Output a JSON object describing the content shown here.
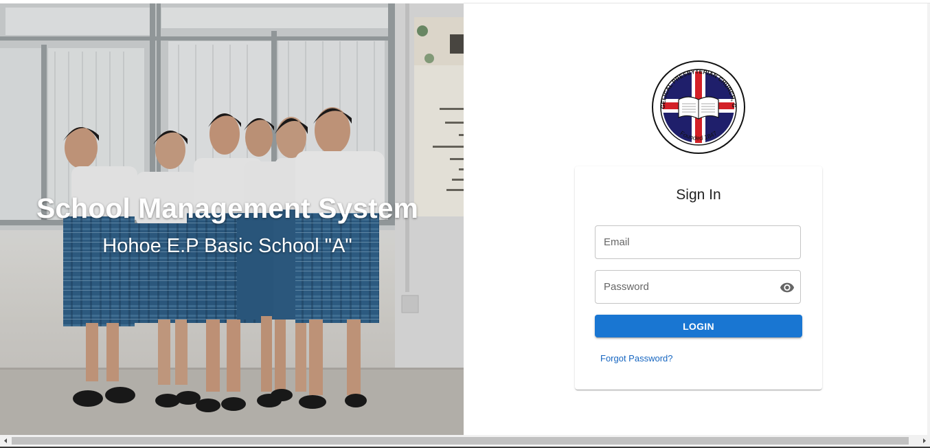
{
  "hero": {
    "title": "School Management System",
    "subtitle": "Hohoe E.P Basic School \"A\""
  },
  "logo": {
    "arc_text_top": "EVANGELICAL PRESBYTERIAN CHURCH, GHANA",
    "arc_text_bottom": "Founded 1847"
  },
  "signin": {
    "title": "Sign In",
    "email_placeholder": "Email",
    "email_value": "",
    "password_placeholder": "Password",
    "password_value": "",
    "login_label": "LOGIN",
    "forgot_label": "Forgot Password?"
  },
  "icons": {
    "password_toggle": "eye-icon",
    "scroll_left": "scroll-left-arrow-icon",
    "scroll_right": "scroll-right-arrow-icon"
  },
  "colors": {
    "primary": "#1976d2",
    "link": "#1565c0",
    "logo_navy": "#1f1f6b",
    "logo_red": "#d32027"
  }
}
